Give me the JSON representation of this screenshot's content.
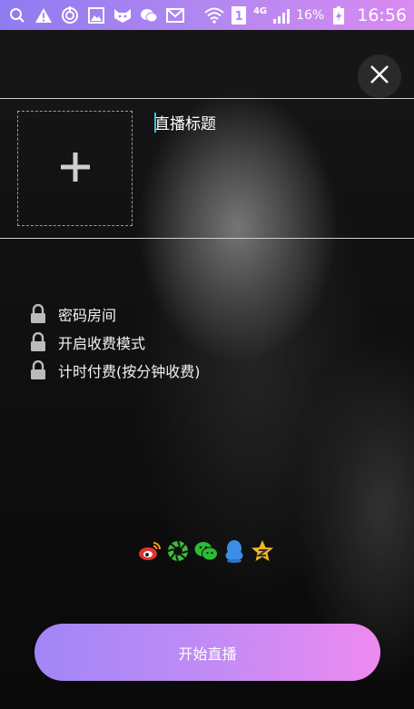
{
  "status_bar": {
    "battery": "16%",
    "network": "4G",
    "sim": "1",
    "time": "16:56",
    "icons": [
      "search-icon",
      "warning-icon",
      "sync-icon",
      "image-icon",
      "cat-icon",
      "wechat-icon",
      "mail-icon",
      "wifi-icon",
      "sim-icon",
      "signal-icon",
      "battery-icon"
    ]
  },
  "header": {
    "close_icon": "close-icon"
  },
  "cover": {
    "icon": "plus-icon"
  },
  "title_input": {
    "placeholder": "直播标题",
    "value": ""
  },
  "options": [
    {
      "label": "密码房间",
      "icon": "lock-icon"
    },
    {
      "label": "开启收费模式",
      "icon": "lock-icon"
    },
    {
      "label": "计时付费(按分钟收费)",
      "icon": "lock-icon"
    }
  ],
  "share": [
    {
      "name": "weibo-icon",
      "color": "#e0342f"
    },
    {
      "name": "moments-icon",
      "color": "#3dbb3b"
    },
    {
      "name": "wechat-icon",
      "color": "#2dbb33"
    },
    {
      "name": "qq-icon",
      "color": "#3a8ee6"
    },
    {
      "name": "qzone-icon",
      "color": "#f5b51e"
    }
  ],
  "start_button": {
    "label": "开始直播"
  },
  "colors": {
    "accent_start": "#a186f7",
    "accent_end": "#ee8af0",
    "caret": "#39c5d6"
  }
}
